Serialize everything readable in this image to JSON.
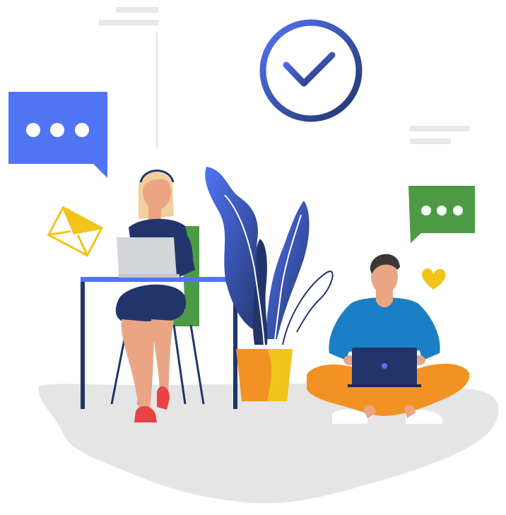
{
  "illustration": {
    "subject": "remote-work-collaboration",
    "colors": {
      "primary_blue": "#5174f5",
      "navy": "#22356b",
      "green": "#4d9a44",
      "yellow": "#f1c41b",
      "orange": "#f39224",
      "skin": "#eaa684",
      "hair_blonde": "#f3cf9b",
      "hair_dark": "#3b3734",
      "laptop_gray": "#d4d6da",
      "ground": "#e5e5e5",
      "placeholder_line": "#e8e8e8",
      "shoe_red": "#e84344",
      "shirt_blue": "#1b7fc5"
    },
    "icons": [
      "clock-check-icon",
      "chat-bubble-icon",
      "envelope-icon",
      "heart-icon"
    ]
  }
}
